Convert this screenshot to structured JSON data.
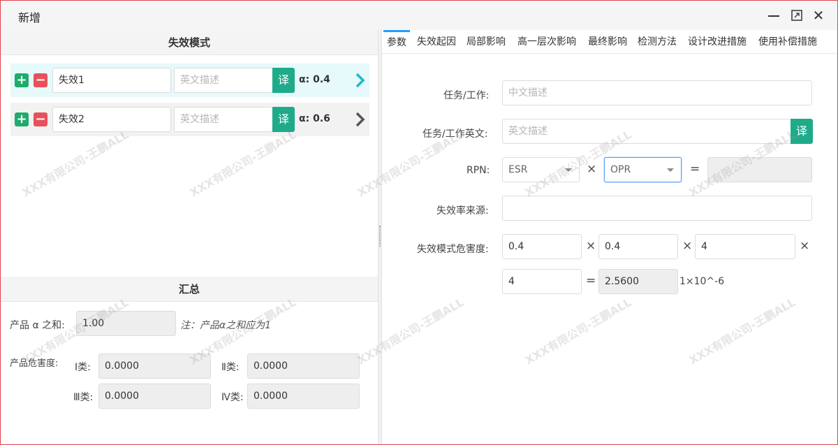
{
  "window": {
    "title": "新增",
    "min_icon": "minimize-icon",
    "max_icon": "maximize-icon",
    "close_icon": "close-icon",
    "close_glyph": "✕"
  },
  "left": {
    "failure_modes_header": "失效模式",
    "failure_modes": [
      {
        "name": "失效1",
        "en_placeholder": "英文描述",
        "translate": "译",
        "alpha": "α: 0.4",
        "active": true
      },
      {
        "name": "失效2",
        "en_placeholder": "英文描述",
        "translate": "译",
        "alpha": "α: 0.6",
        "active": false
      }
    ],
    "summary_header": "汇总",
    "alpha_sum_label": "产品 α 之和:",
    "alpha_sum_value": "1.00",
    "alpha_sum_note": "注：产品α之和应为1",
    "criticality_label": "产品危害度:",
    "class1_label": "Ⅰ类:",
    "class1_value": "0.0000",
    "class2_label": "Ⅱ类:",
    "class2_value": "0.0000",
    "class3_label": "Ⅲ类:",
    "class3_value": "0.0000",
    "class4_label": "Ⅳ类:",
    "class4_value": "0.0000"
  },
  "tabs": [
    "参数",
    "失效起因",
    "局部影响",
    "高一层次影响",
    "最终影响",
    "检测方法",
    "设计改进措施",
    "使用补偿措施"
  ],
  "form": {
    "task_label": "任务/工作:",
    "task_placeholder": "中文描述",
    "task_en_label": "任务/工作英文:",
    "task_en_placeholder": "英文描述",
    "translate": "译",
    "rpn_label": "RPN:",
    "esr_value": "ESR",
    "opr_value": "OPR",
    "times": "×",
    "equals": "=",
    "rate_source_label": "失效率来源:",
    "crit_label": "失效模式危害度:",
    "crit_v1": "0.4",
    "crit_v2": "0.4",
    "crit_v3": "4",
    "crit_v4": "4",
    "crit_result": "2.5600",
    "crit_unit": "1×10^-6"
  },
  "watermark_text": "XXX有限公司-王鹏ALL",
  "colors": {
    "accent": "#1fab8a",
    "tab_active": "#1e9fff",
    "add": "#1fab6b",
    "delete": "#e8515b",
    "border": "#e0424f"
  }
}
